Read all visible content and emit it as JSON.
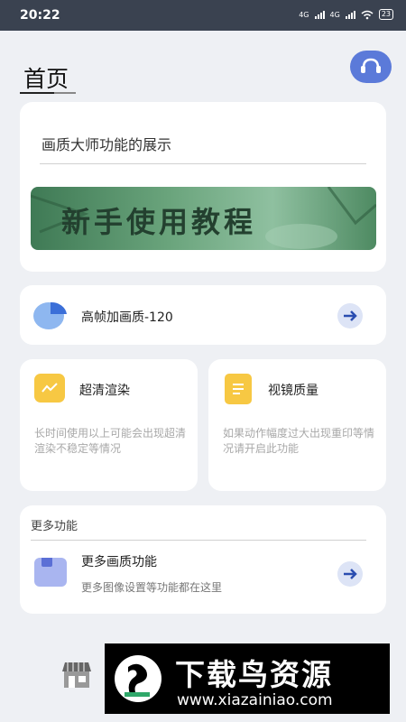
{
  "status_bar": {
    "time": "20:22",
    "network1": "4G",
    "network2": "4G",
    "battery": "23"
  },
  "header": {
    "title": "首页",
    "support_icon": "headset-icon"
  },
  "quality_master_card": {
    "title": "画质大师功能的展示",
    "banner_text": "新手使用教程"
  },
  "high_fps_card": {
    "icon": "pie-icon",
    "label": "高帧加画质-120"
  },
  "features": [
    {
      "icon": "chart-note-icon",
      "title": "超清渲染",
      "desc": "长时间使用以上可能会出现超清渲染不稳定等情况"
    },
    {
      "icon": "document-icon",
      "title": "视镜质量",
      "desc": "如果动作幅度过大出现重印等情况请开启此功能"
    }
  ],
  "more_card": {
    "section_title": "更多功能",
    "icon": "bookmark-box-icon",
    "label": "更多画质功能",
    "desc": "更多图像设置等功能都在这里"
  },
  "bottom_nav": {
    "icon": "store-icon"
  },
  "watermark": {
    "title": "下载鸟资源",
    "url": "www.xiazainiao.com"
  },
  "colors": {
    "accent": "#5b7ad9",
    "feature_icon": "#f7c843",
    "background": "#eef0f4"
  }
}
